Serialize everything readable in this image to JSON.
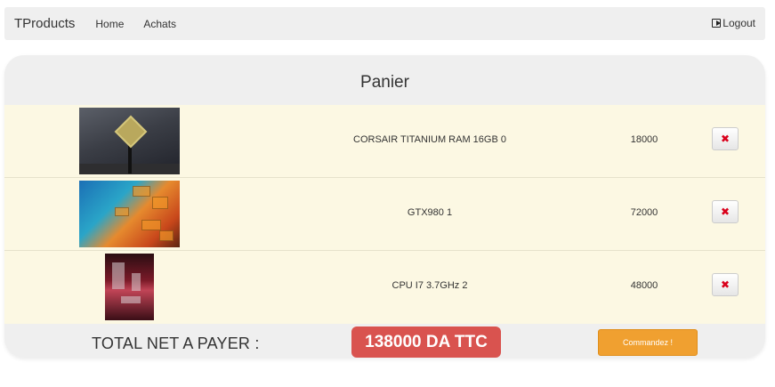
{
  "navbar": {
    "brand": "TProducts",
    "links": [
      "Home",
      "Achats"
    ],
    "logout_label": "Logout"
  },
  "panel": {
    "title": "Panier"
  },
  "cart": {
    "items": [
      {
        "name": "CORSAIR TITANIUM RAM 16GB 0",
        "price": "18000",
        "image": "cpu-chip-photo"
      },
      {
        "name": "GTX980 1",
        "price": "72000",
        "image": "gpu-die-photo"
      },
      {
        "name": "CPU I7 3.7GHz 2",
        "price": "48000",
        "image": "pc-case-photo"
      }
    ],
    "remove_icon": "x-icon"
  },
  "total": {
    "label": "TOTAL NET A PAYER :",
    "value": "138000 DA TTC",
    "order_label": "Commandez !"
  },
  "colors": {
    "row_bg": "#fcf8e3",
    "panel_bg": "#efefef",
    "total_badge": "#d9534f",
    "order_button": "#f0a030",
    "remove_icon": "#d9001b"
  }
}
